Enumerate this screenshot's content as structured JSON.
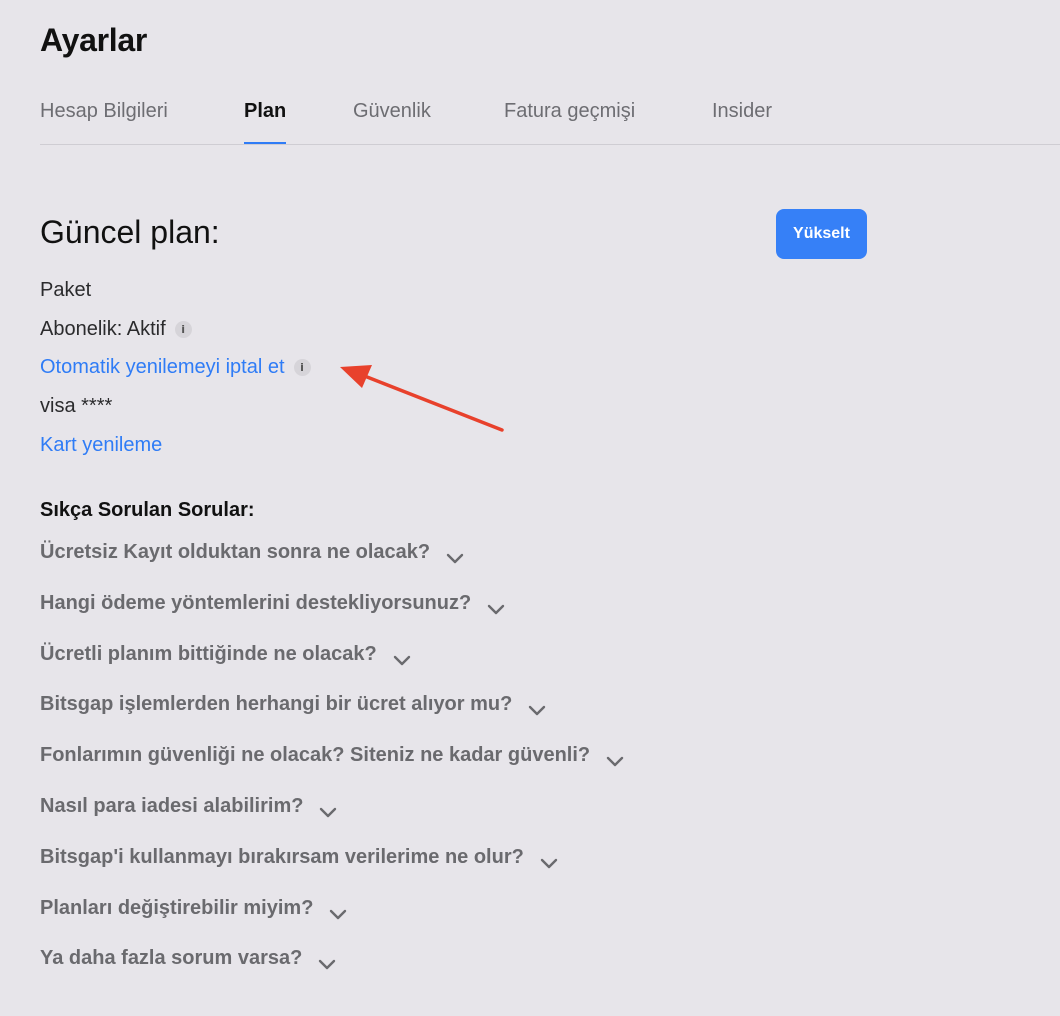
{
  "page": {
    "title": "Ayarlar"
  },
  "tabs": [
    {
      "label": "Hesap Bilgileri",
      "active": false
    },
    {
      "label": "Plan",
      "active": true
    },
    {
      "label": "Güvenlik",
      "active": false
    },
    {
      "label": "Fatura geçmişi",
      "active": false
    },
    {
      "label": "Insider",
      "active": false
    }
  ],
  "plan": {
    "heading": "Güncel plan:",
    "upgrade_label": "Yükselt",
    "package_label": "Paket",
    "subscription_label": "Abonelik: Aktif",
    "cancel_renewal_label": "Otomatik yenilemeyi iptal et",
    "card_label": "visa ****",
    "card_renew_label": "Kart yenileme",
    "info_glyph": "i"
  },
  "faq": {
    "title": "Sıkça Sorulan Sorular:",
    "items": [
      "Ücretsiz Kayıt olduktan sonra ne olacak?",
      "Hangi ödeme yöntemlerini destekliyorsunuz?",
      "Ücretli planım bittiğinde ne olacak?",
      "Bitsgap işlemlerden herhangi bir ücret alıyor mu?",
      "Fonlarımın güvenliği ne olacak? Siteniz ne kadar güvenli?",
      "Nasıl para iadesi alabilirim?",
      "Bitsgap'i kullanmayı bırakırsam verilerime ne olur?",
      "Planları değiştirebilir miyim?",
      "Ya daha fazla sorum varsa?"
    ]
  },
  "colors": {
    "background": "#e7e5ea",
    "accent": "#2f7cf6",
    "button": "#3680f7",
    "annotation_arrow": "#e8412c"
  },
  "icons": {
    "info": "info-icon",
    "faq_toggle": "chevron-down-icon"
  }
}
